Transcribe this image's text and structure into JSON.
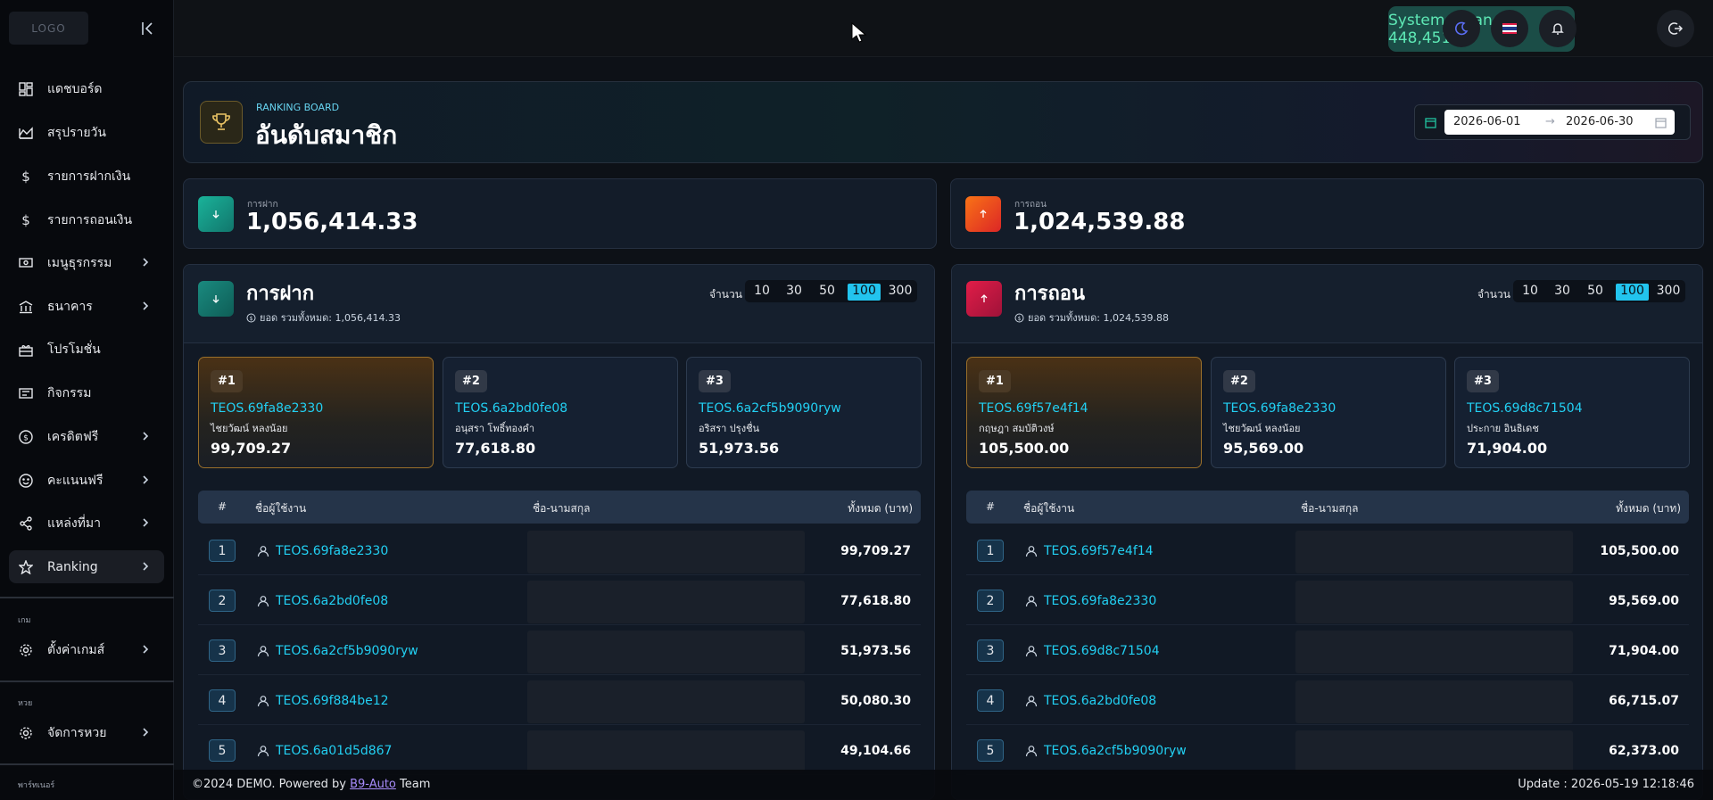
{
  "sidebar": {
    "logo": "LOGO",
    "items": [
      {
        "label": "แดชบอร์ด"
      },
      {
        "label": "สรุปรายวัน"
      },
      {
        "label": "รายการฝากเงิน"
      },
      {
        "label": "รายการถอนเงิน"
      },
      {
        "label": "เมนูธุรกรรม"
      },
      {
        "label": "ธนาคาร"
      },
      {
        "label": "โปรโมชั่น"
      },
      {
        "label": "กิจกรรม"
      },
      {
        "label": "เครดิตฟรี"
      },
      {
        "label": "คะแนนฟรี"
      },
      {
        "label": "แหล่งที่มา"
      },
      {
        "label": "Ranking"
      }
    ],
    "section_game": "เกม",
    "game_settings": "ตั้งค่าเกมส์",
    "section_lotto": "หวย",
    "lotto_manage": "จัดการหวย",
    "section_partner": "พาร์ทเนอร์"
  },
  "topbar": {
    "balance": "System Balance : 448,451.32",
    "separator": "|"
  },
  "hero": {
    "subtitle": "RANKING BOARD",
    "title": "อันดับสมาชิก",
    "date_from": "2026-06-01",
    "date_arrow": "→",
    "date_to": "2026-06-30"
  },
  "stats": {
    "deposit": {
      "label": "การฝาก",
      "value": "1,056,414.33"
    },
    "withdraw": {
      "label": "การถอน",
      "value": "1,024,539.88"
    }
  },
  "panels": {
    "deposit": {
      "title": "การฝาก",
      "total": "ยอด  รวมทั้งหมด: 1,056,414.33",
      "count_label": "จำนวน",
      "counts": [
        "10",
        "30",
        "50",
        "100",
        "300"
      ],
      "top3": [
        {
          "rank": "#1",
          "id": "TEOS.69fa8e2330",
          "name": "ไชยวัฒน์ หลงน้อย",
          "amount": "99,709.27"
        },
        {
          "rank": "#2",
          "id": "TEOS.6a2bd0fe08",
          "name": "อนุสรา โพธิ์ทองคำ",
          "amount": "77,618.80"
        },
        {
          "rank": "#3",
          "id": "TEOS.6a2cf5b9090ryw",
          "name": "อริสรา ปรุงชื่น",
          "amount": "51,973.56"
        }
      ],
      "headers": {
        "no": "#",
        "user": "ชื่อผู้ใช้งาน",
        "name": "ชื่อ-นามสกุล",
        "total": "ทั้งหมด (บาท)"
      },
      "rows": [
        {
          "no": "1",
          "id": "TEOS.69fa8e2330",
          "amount": "99,709.27"
        },
        {
          "no": "2",
          "id": "TEOS.6a2bd0fe08",
          "amount": "77,618.80"
        },
        {
          "no": "3",
          "id": "TEOS.6a2cf5b9090ryw",
          "amount": "51,973.56"
        },
        {
          "no": "4",
          "id": "TEOS.69f884be12",
          "amount": "50,080.30"
        },
        {
          "no": "5",
          "id": "TEOS.6a01d5d867",
          "amount": "49,104.66"
        }
      ]
    },
    "withdraw": {
      "title": "การถอน",
      "total": "ยอด  รวมทั้งหมด: 1,024,539.88",
      "count_label": "จำนวน",
      "counts": [
        "10",
        "30",
        "50",
        "100",
        "300"
      ],
      "top3": [
        {
          "rank": "#1",
          "id": "TEOS.69f57e4f14",
          "name": "กฤษฎา สมบัติวงษ์",
          "amount": "105,500.00"
        },
        {
          "rank": "#2",
          "id": "TEOS.69fa8e2330",
          "name": "ไชยวัฒน์ หลงน้อย",
          "amount": "95,569.00"
        },
        {
          "rank": "#3",
          "id": "TEOS.69d8c71504",
          "name": "ประกาย อินธิเดช",
          "amount": "71,904.00"
        }
      ],
      "headers": {
        "no": "#",
        "user": "ชื่อผู้ใช้งาน",
        "name": "ชื่อ-นามสกุล",
        "total": "ทั้งหมด (บาท)"
      },
      "rows": [
        {
          "no": "1",
          "id": "TEOS.69f57e4f14",
          "amount": "105,500.00"
        },
        {
          "no": "2",
          "id": "TEOS.69fa8e2330",
          "amount": "95,569.00"
        },
        {
          "no": "3",
          "id": "TEOS.69d8c71504",
          "amount": "71,904.00"
        },
        {
          "no": "4",
          "id": "TEOS.6a2bd0fe08",
          "amount": "66,715.07"
        },
        {
          "no": "5",
          "id": "TEOS.6a2cf5b9090ryw",
          "amount": "62,373.00"
        }
      ]
    }
  },
  "footer": {
    "copyright_prefix": "©2024 DEMO. Powered by ",
    "link": "B9-Auto",
    "copyright_suffix": " Team",
    "update": "Update : 2026-05-19 12:18:46"
  }
}
